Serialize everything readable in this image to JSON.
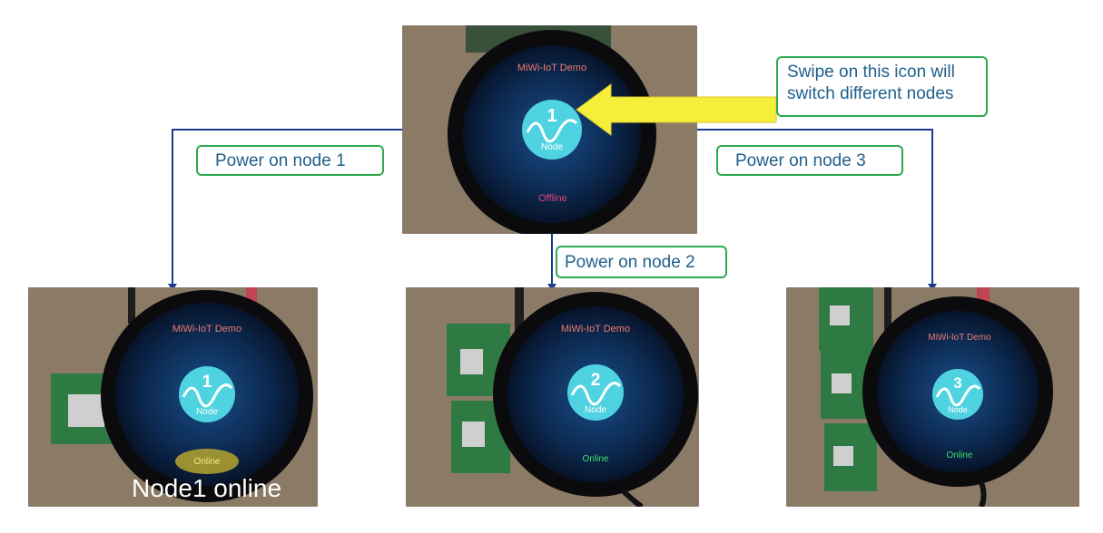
{
  "devices": {
    "top": {
      "title": "MiWi-IoT Demo",
      "node_number": "1",
      "node_label": "Node",
      "status": "Offline"
    },
    "left": {
      "title": "MiWi-IoT Demo",
      "node_number": "1",
      "node_label": "Node",
      "status": "Online"
    },
    "mid": {
      "title": "MiWi-IoT Demo",
      "node_number": "2",
      "node_label": "Node",
      "status": "Online"
    },
    "right": {
      "title": "MiWi-IoT Demo",
      "node_number": "3",
      "node_label": "Node",
      "status": "Online"
    }
  },
  "callouts": {
    "swipe_line1": "Swipe on this icon will",
    "swipe_line2": "switch different nodes",
    "power_node1": "Power on node 1",
    "power_node2": "Power on node 2",
    "power_node3": "Power on node 3"
  },
  "captions": {
    "node1_online": "Node1 online"
  },
  "colors": {
    "connector": "#1a3c8c",
    "callout_border": "#2eaa4f",
    "callout_text": "#1f5f8b",
    "arrow_fill": "#f5ee3a",
    "title_text": "#f07a6a",
    "offline_text": "#e0407a",
    "online_text": "#3ee06a",
    "highlight_online_text": "#f0ee80",
    "icon_fill": "#4fd3e0"
  }
}
